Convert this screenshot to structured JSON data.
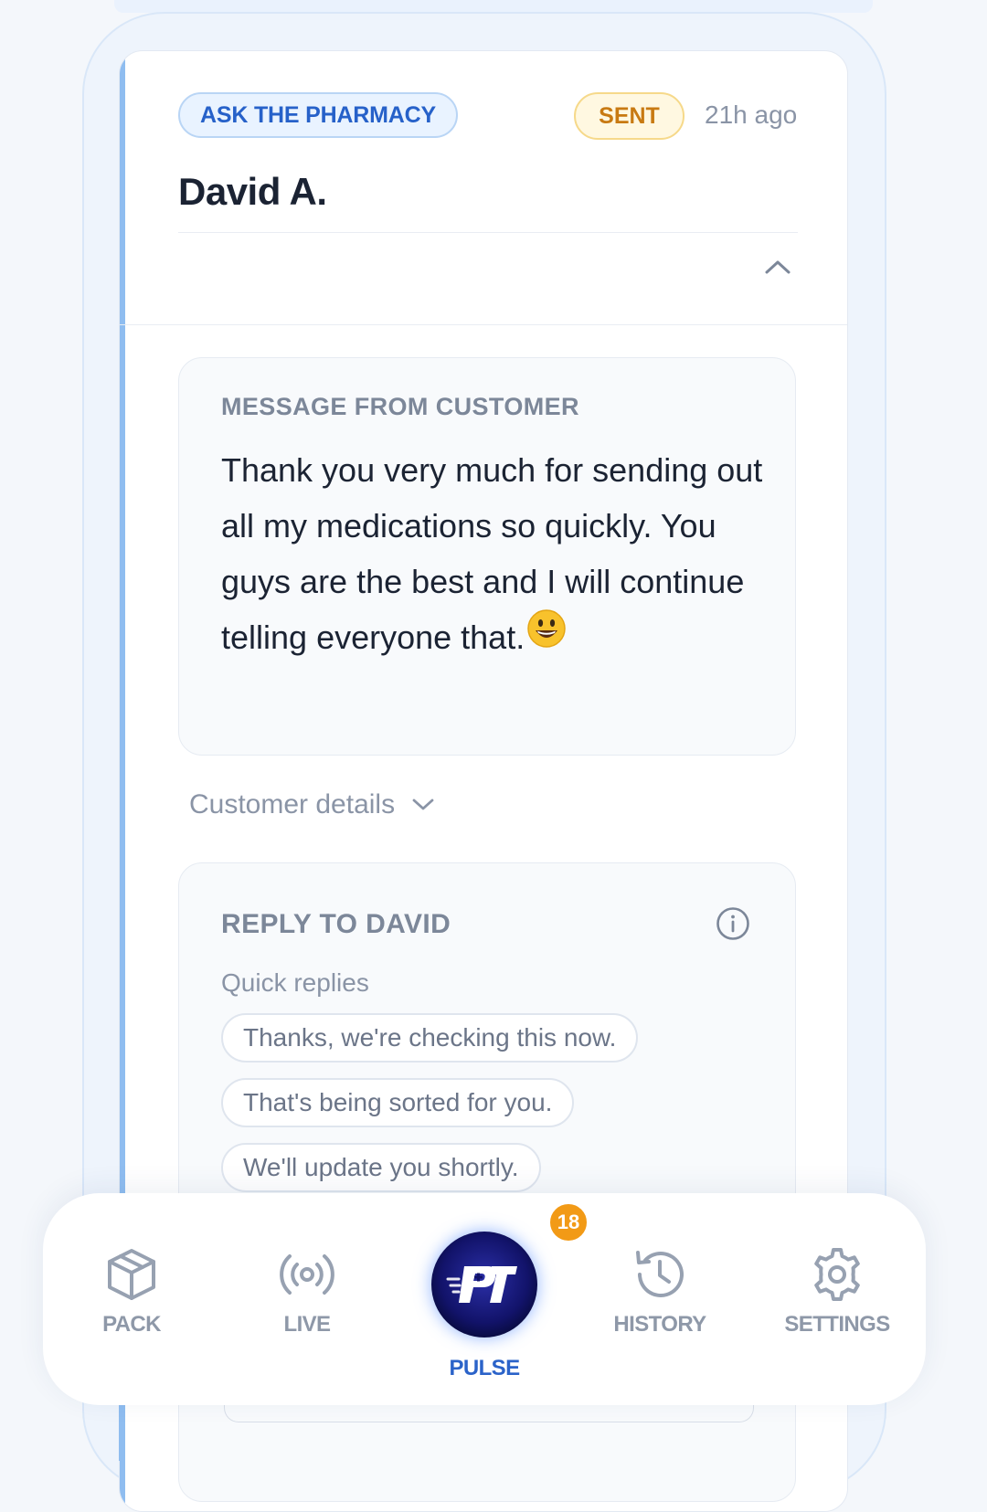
{
  "card": {
    "category_badge": "ASK THE PHARMACY",
    "status_badge": "SENT",
    "time_ago": "21h ago",
    "customer_name": "David A."
  },
  "message": {
    "label": "MESSAGE FROM CUSTOMER",
    "text": "Thank you very much for sending out all my medications so quickly. You guys are the best and I  will continue telling everyone that.",
    "emoji": "grinning-face"
  },
  "customer_details": {
    "label": "Customer details"
  },
  "reply": {
    "label": "REPLY TO DAVID",
    "quick_replies_label": "Quick replies",
    "quick_replies": [
      "Thanks, we're checking this now.",
      "That's being sorted for you.",
      "We'll update you shortly."
    ]
  },
  "nav": {
    "items": [
      {
        "label": "PACK",
        "icon": "box-icon"
      },
      {
        "label": "LIVE",
        "icon": "broadcast-icon"
      },
      {
        "label": "PULSE",
        "icon": "pt-logo",
        "badge": "18",
        "active": true
      },
      {
        "label": "HISTORY",
        "icon": "history-icon"
      },
      {
        "label": "SETTINGS",
        "icon": "gear-icon"
      }
    ]
  },
  "colors": {
    "accent_blue": "#2661c9",
    "sent_orange": "#c87a12",
    "badge_orange": "#f29a16",
    "card_stripe": "#8fbdf0"
  }
}
